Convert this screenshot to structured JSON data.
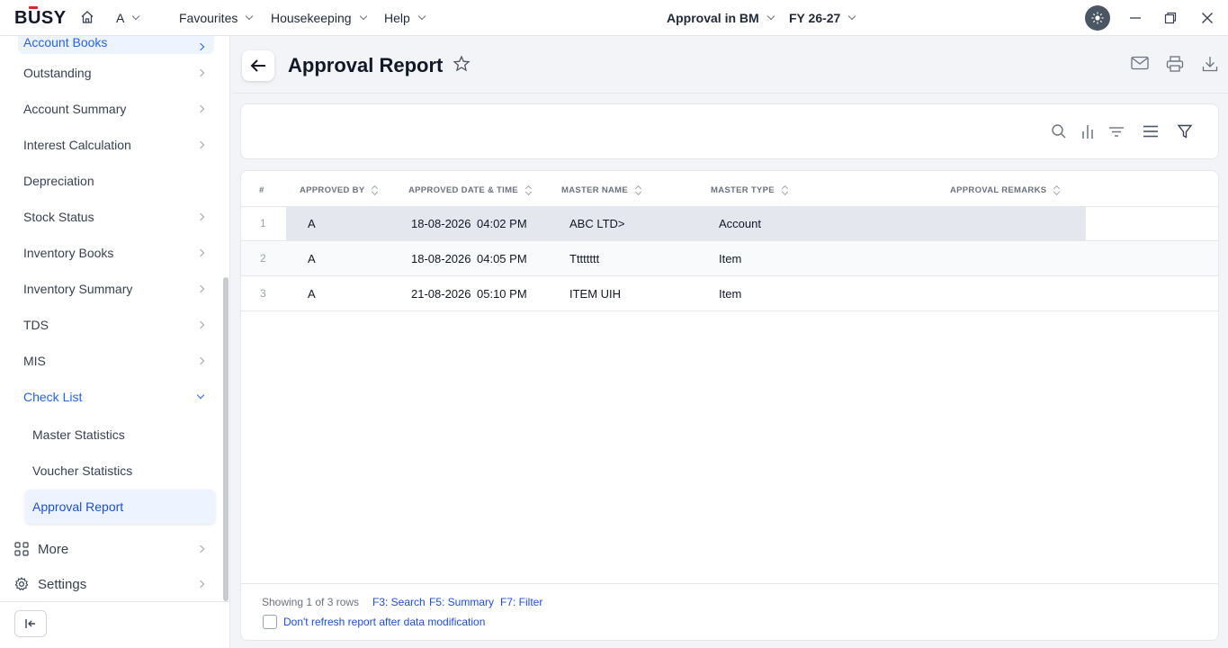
{
  "app": {
    "logo": "BUSY",
    "user": "A"
  },
  "topnav": {
    "menus": [
      "Favourites",
      "Housekeeping",
      "Help"
    ],
    "company": "Approval in BM",
    "fy": "FY 26-27"
  },
  "sidebar": {
    "items": [
      {
        "label": "Account Books",
        "active": true
      },
      {
        "label": "Outstanding"
      },
      {
        "label": "Account Summary"
      },
      {
        "label": "Interest Calculation"
      },
      {
        "label": "Depreciation"
      },
      {
        "label": "Stock Status"
      },
      {
        "label": "Inventory Books"
      },
      {
        "label": "Inventory Summary"
      },
      {
        "label": "TDS"
      },
      {
        "label": "MIS"
      },
      {
        "label": "Check List",
        "expanded": true
      }
    ],
    "subitems": [
      "Master Statistics",
      "Voucher Statistics",
      "Approval Report"
    ],
    "more": "More",
    "settings": "Settings"
  },
  "page": {
    "title": "Approval Report"
  },
  "table": {
    "columns": [
      "#",
      "APPROVED BY",
      "APPROVED DATE & TIME",
      "MASTER NAME",
      "MASTER TYPE",
      "APPROVAL REMARKS"
    ],
    "rows": [
      {
        "num": "1",
        "approved_by": "A",
        "date": "18-08-2026",
        "time": "04:02 PM",
        "master_name": "ABC LTD>",
        "master_type": "Account",
        "remarks": ""
      },
      {
        "num": "2",
        "approved_by": "A",
        "date": "18-08-2026",
        "time": "04:05 PM",
        "master_name": "Tttttttt",
        "master_type": "Item",
        "remarks": ""
      },
      {
        "num": "3",
        "approved_by": "A",
        "date": "21-08-2026",
        "time": "05:10 PM",
        "master_name": "ITEM UIH",
        "master_type": "Item",
        "remarks": ""
      }
    ]
  },
  "footer": {
    "showing": "Showing 1 of 3 rows",
    "keys": [
      "F3: Search",
      "F5: Summary",
      "F7: Filter"
    ],
    "refresh_label": "Don't refresh report after data modification"
  },
  "colors": {
    "accent": "#2563eb",
    "brand_red": "#e02424",
    "active_bg": "#eef4ff"
  }
}
